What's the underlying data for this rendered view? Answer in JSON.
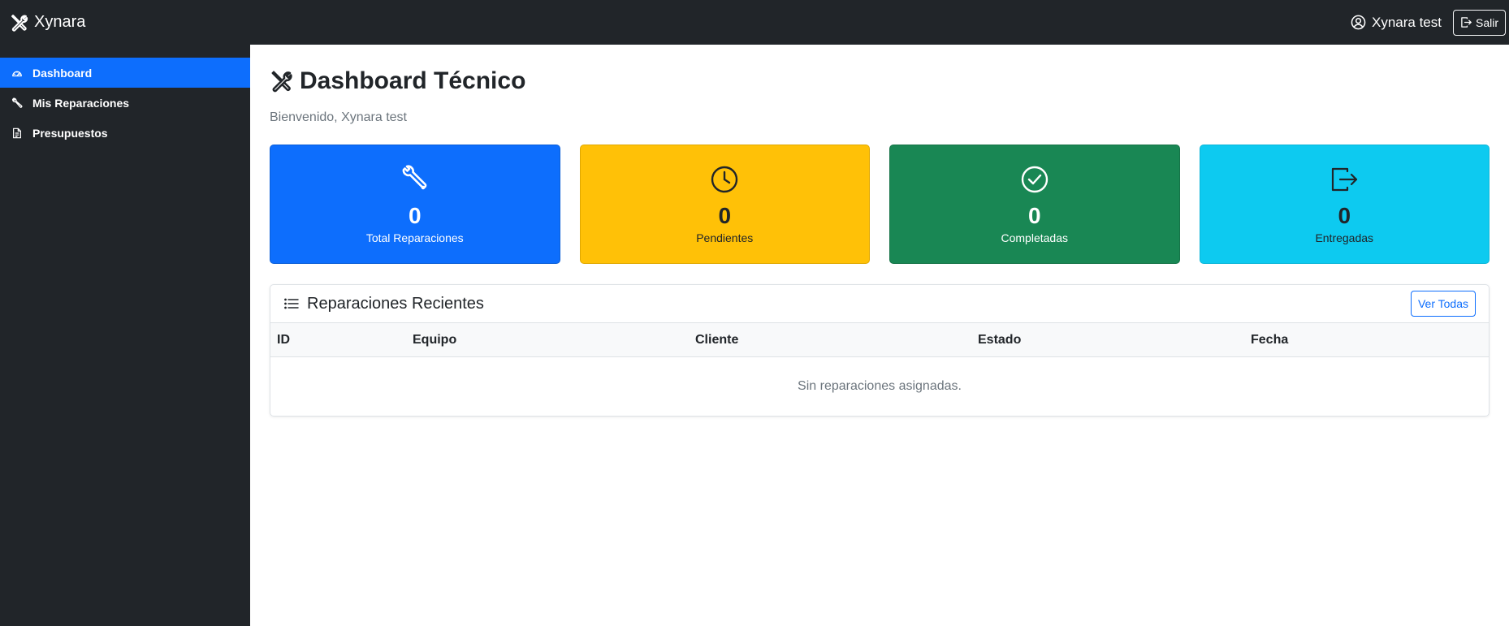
{
  "app": {
    "brand": "Xynara"
  },
  "user": {
    "name": "Xynara test",
    "logout_label": "Salir"
  },
  "sidebar": {
    "items": [
      {
        "label": "Dashboard",
        "icon": "speedometer-icon",
        "active": true
      },
      {
        "label": "Mis Reparaciones",
        "icon": "wrench-icon",
        "active": false
      },
      {
        "label": "Presupuestos",
        "icon": "document-icon",
        "active": false
      }
    ]
  },
  "page": {
    "title": "Dashboard Técnico",
    "welcome": "Bienvenido, Xynara test"
  },
  "cards": [
    {
      "value": "0",
      "label": "Total Reparaciones",
      "icon": "wrench-icon",
      "color": "#0d6efd"
    },
    {
      "value": "0",
      "label": "Pendientes",
      "icon": "clock-icon",
      "color": "#ffc107"
    },
    {
      "value": "0",
      "label": "Completadas",
      "icon": "check-circle-icon",
      "color": "#198754"
    },
    {
      "value": "0",
      "label": "Entregadas",
      "icon": "box-arrow-right-icon",
      "color": "#0dcaf0"
    }
  ],
  "recent": {
    "title": "Reparaciones Recientes",
    "view_all_label": "Ver Todas",
    "columns": [
      "ID",
      "Equipo",
      "Cliente",
      "Estado",
      "Fecha"
    ],
    "empty_text": "Sin reparaciones asignadas."
  },
  "colors": {
    "dark": "#212529",
    "primary": "#0d6efd",
    "warning": "#ffc107",
    "success": "#198754",
    "info": "#0dcaf0"
  }
}
